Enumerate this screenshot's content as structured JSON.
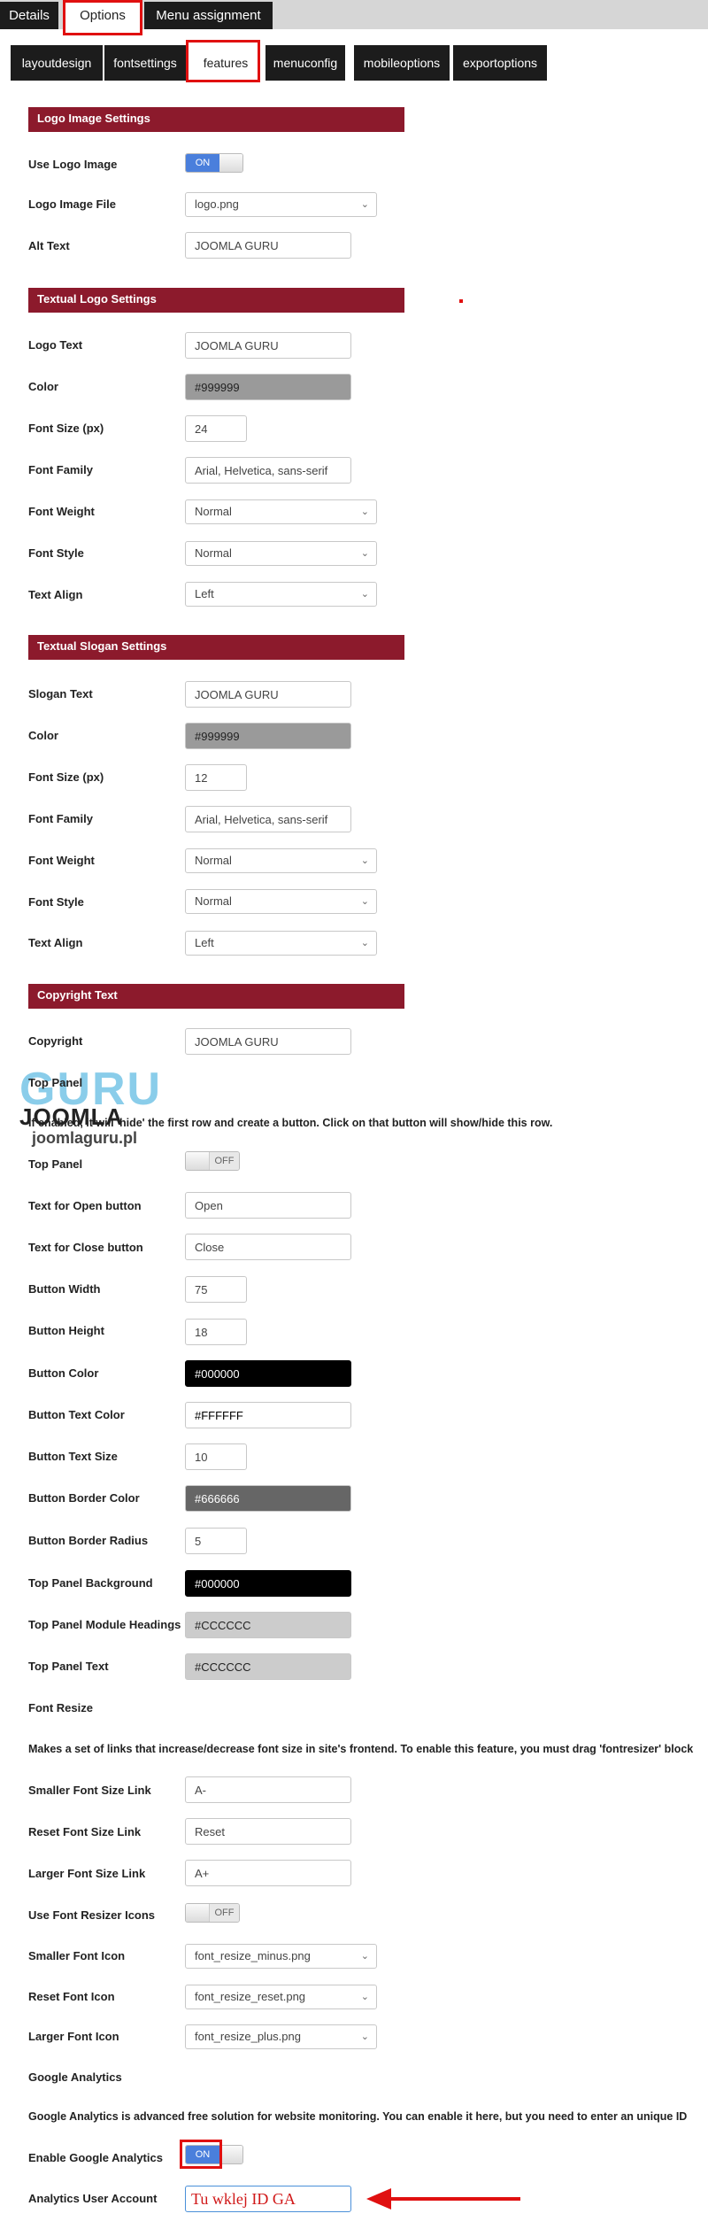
{
  "top_tabs": [
    "Details",
    "Options",
    "Menu assignment"
  ],
  "sub_tabs": [
    "layoutdesign",
    "fontsettings",
    "features",
    "menuconfig",
    "mobileoptions",
    "exportoptions"
  ],
  "sections": {
    "logo_image": "Logo Image Settings",
    "textual_logo": "Textual Logo Settings",
    "textual_slogan": "Textual Slogan Settings",
    "copyright": "Copyright Text"
  },
  "toggle_labels": {
    "on": "ON",
    "off": "OFF"
  },
  "logo_image": {
    "use_logo_label": "Use Logo Image",
    "use_logo_state": "ON",
    "file_label": "Logo Image File",
    "file_value": "logo.png",
    "alt_label": "Alt Text",
    "alt_value": "JOOMLA GURU"
  },
  "textual_logo": {
    "text_label": "Logo Text",
    "text_value": "JOOMLA GURU",
    "color_label": "Color",
    "color_value": "#999999",
    "size_label": "Font Size (px)",
    "size_value": "24",
    "family_label": "Font Family",
    "family_value": "Arial, Helvetica, sans-serif",
    "weight_label": "Font Weight",
    "weight_value": "Normal",
    "style_label": "Font Style",
    "style_value": "Normal",
    "align_label": "Text Align",
    "align_value": "Left"
  },
  "textual_slogan": {
    "text_label": "Slogan Text",
    "text_value": "JOOMLA GURU",
    "color_label": "Color",
    "color_value": "#999999",
    "size_label": "Font Size (px)",
    "size_value": "12",
    "family_label": "Font Family",
    "family_value": "Arial, Helvetica, sans-serif",
    "weight_label": "Font Weight",
    "weight_value": "Normal",
    "style_label": "Font Style",
    "style_value": "Normal",
    "align_label": "Text Align",
    "align_value": "Left"
  },
  "copyright": {
    "label": "Copyright",
    "value": "JOOMLA GURU"
  },
  "top_panel": {
    "heading": "Top Panel",
    "description": "If enabled, it will 'hide' the first row and create a button. Click on that button will show/hide this row.",
    "toggle_label": "Top Panel",
    "toggle_state": "OFF",
    "open_label": "Text for Open button",
    "open_value": "Open",
    "close_label": "Text for Close button",
    "close_value": "Close",
    "width_label": "Button Width",
    "width_value": "75",
    "height_label": "Button Height",
    "height_value": "18",
    "btn_color_label": "Button Color",
    "btn_color_value": "#000000",
    "btn_text_color_label": "Button Text Color",
    "btn_text_color_value": "#FFFFFF",
    "btn_text_size_label": "Button Text Size",
    "btn_text_size_value": "10",
    "btn_border_color_label": "Button Border Color",
    "btn_border_color_value": "#666666",
    "btn_border_radius_label": "Button Border Radius",
    "btn_border_radius_value": "5",
    "bg_label": "Top Panel Background",
    "bg_value": "#000000",
    "module_headings_label": "Top Panel Module Headings",
    "module_headings_value": "#CCCCCC",
    "text_label": "Top Panel Text",
    "text_value": "#CCCCCC"
  },
  "font_resize": {
    "heading": "Font Resize",
    "description": "Makes a set of links that increase/decrease font size in site's frontend. To enable this feature, you must drag 'fontresizer' block",
    "smaller_label": "Smaller Font Size Link",
    "smaller_value": "A-",
    "reset_label": "Reset Font Size Link",
    "reset_value": "Reset",
    "larger_label": "Larger Font Size Link",
    "larger_value": "A+",
    "icons_label": "Use Font Resizer Icons",
    "icons_state": "OFF",
    "smaller_icon_label": "Smaller Font Icon",
    "smaller_icon_value": "font_resize_minus.png",
    "reset_icon_label": "Reset Font Icon",
    "reset_icon_value": "font_resize_reset.png",
    "larger_icon_label": "Larger Font Icon",
    "larger_icon_value": "font_resize_plus.png"
  },
  "google_analytics": {
    "heading": "Google Analytics",
    "description": "Google Analytics is advanced free solution for website monitoring. You can enable it here, but you need to enter an unique ID",
    "enable_label": "Enable Google Analytics",
    "enable_state": "ON",
    "account_label": "Analytics User Account",
    "account_value": "Tu wklej ID GA"
  },
  "watermark": {
    "line1": "GURU",
    "line2": "JOOMLA",
    "line3": "joomlaguru.pl"
  },
  "colors": {
    "section_header": "#8c1a2c",
    "toggle_on": "#4a7fdc",
    "highlight": "#e01010"
  }
}
